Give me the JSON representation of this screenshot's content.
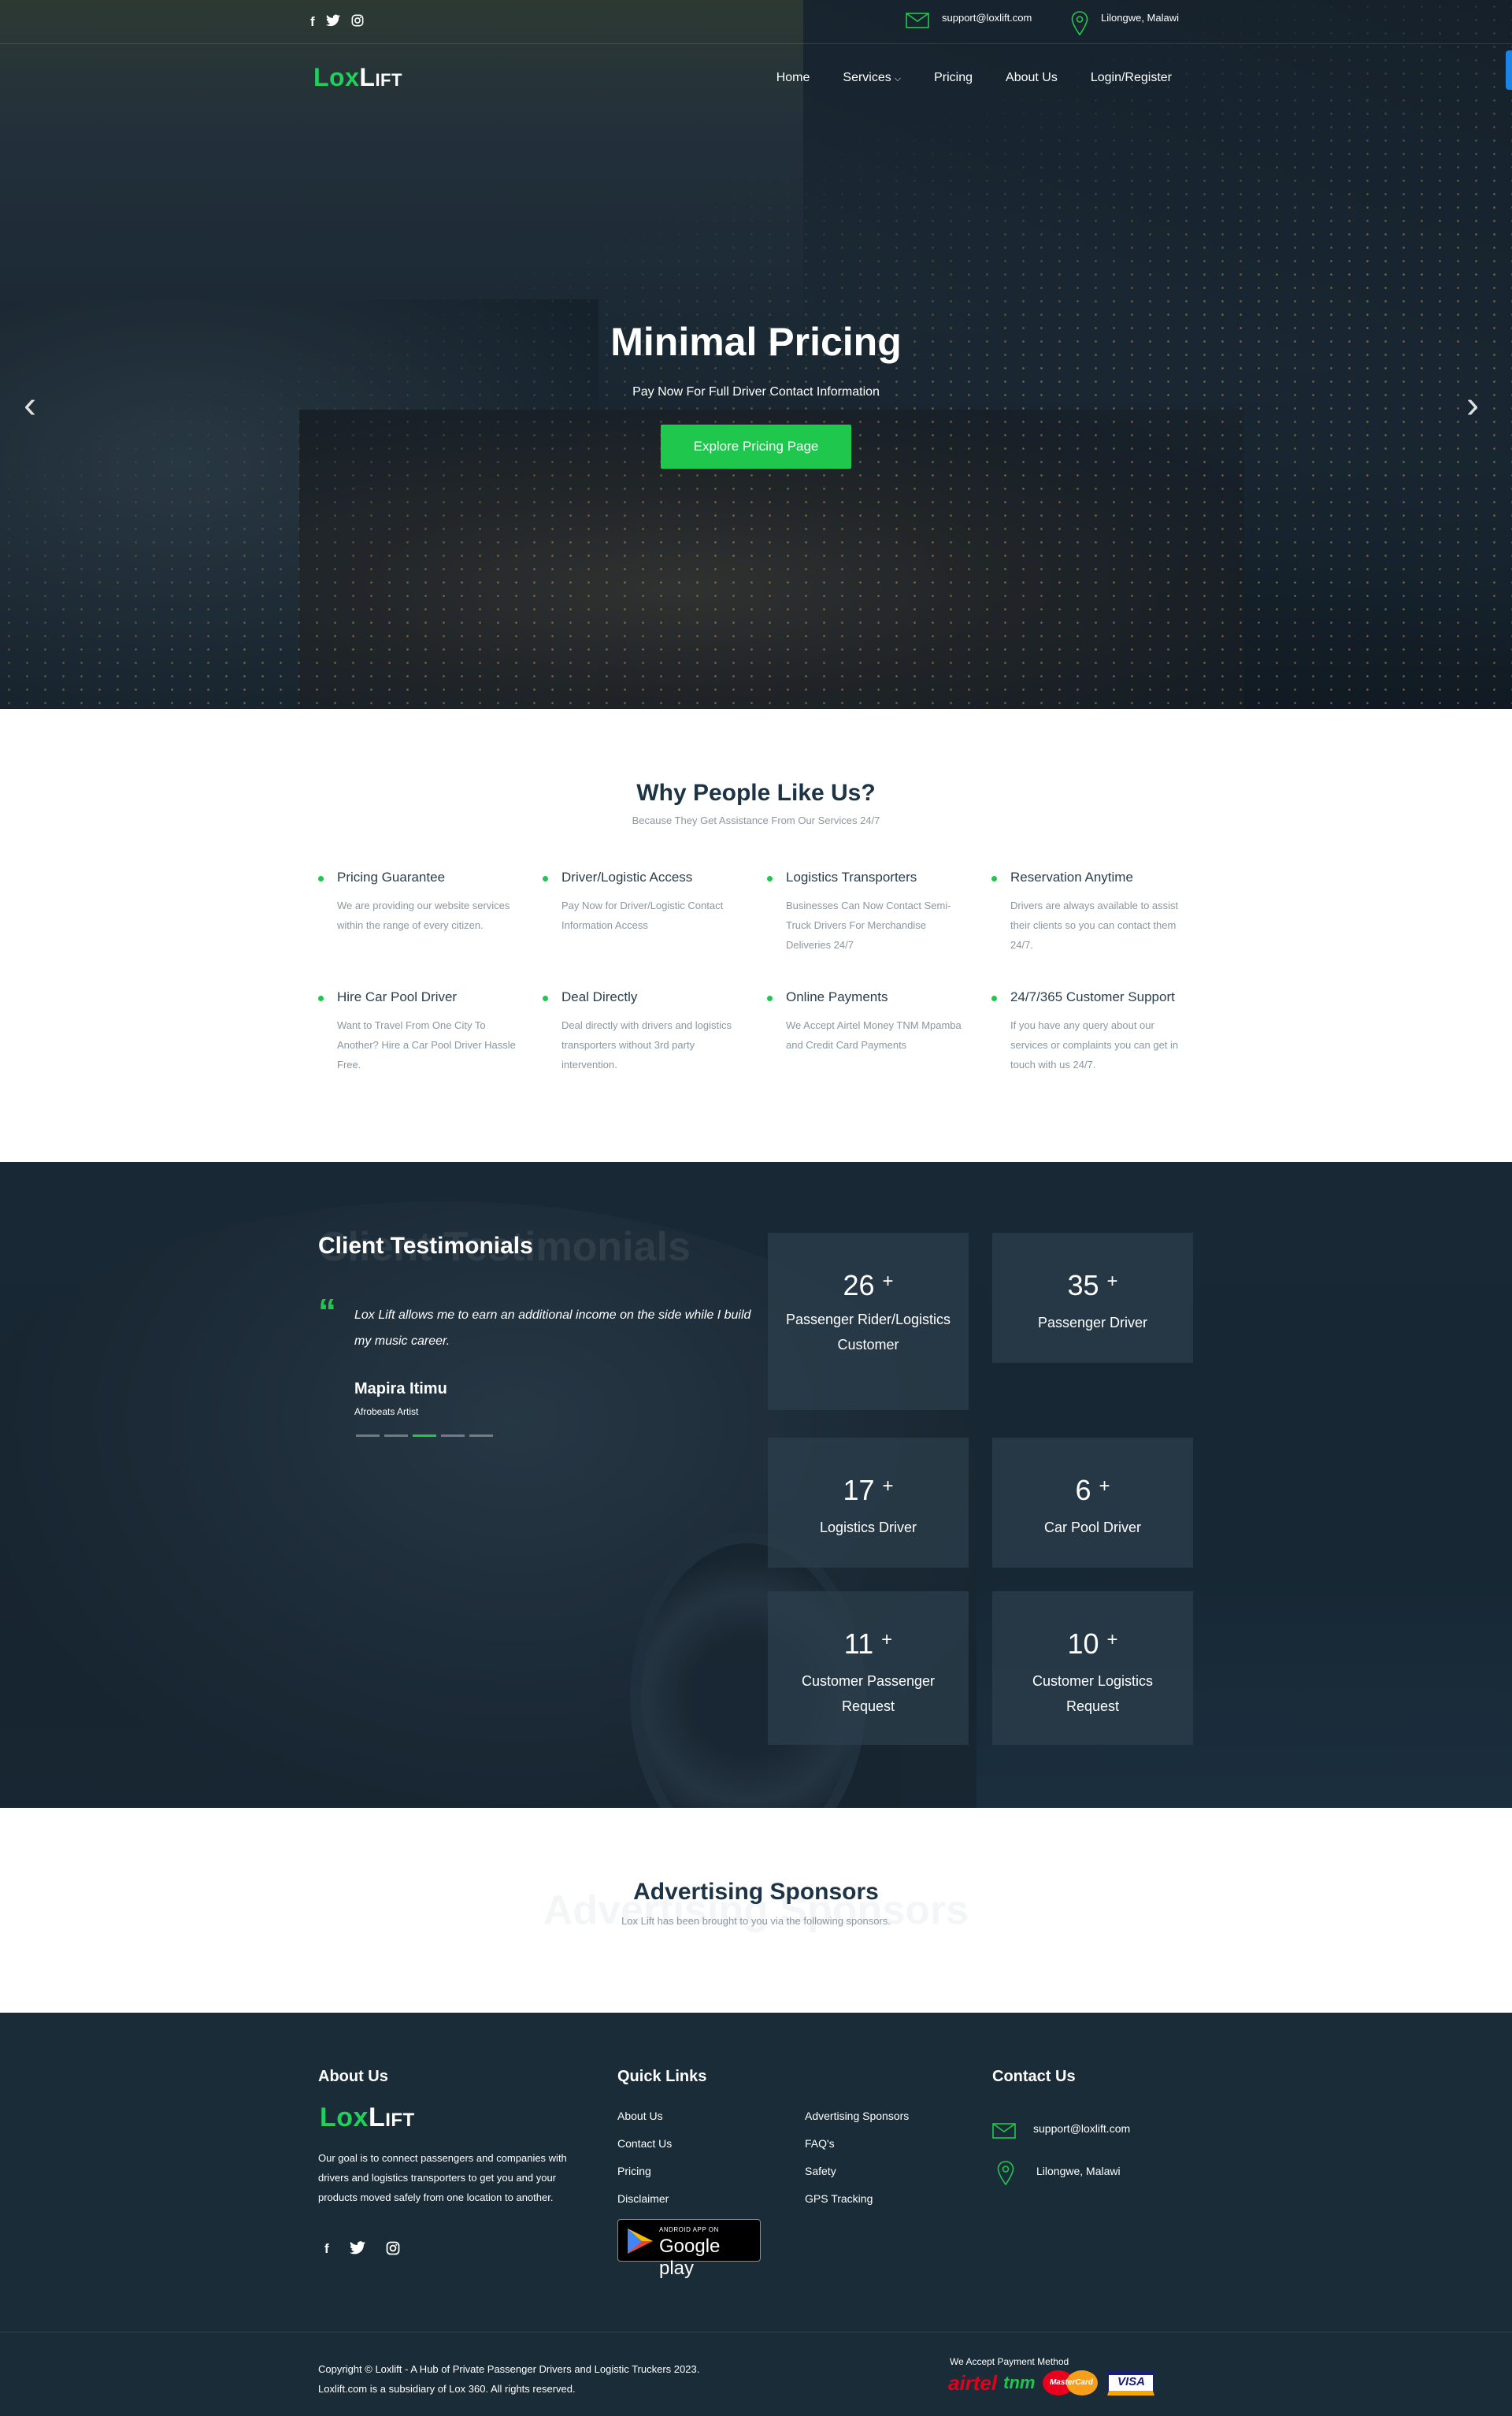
{
  "topbar": {
    "social": [
      "f",
      "🐦",
      "◎"
    ],
    "email": "support@loxlift.com",
    "location": "Lilongwe, Malawi"
  },
  "brand": {
    "part1": "Lox",
    "part2": "Lift"
  },
  "nav": [
    {
      "label": "Home"
    },
    {
      "label": "Services",
      "has_dropdown": true
    },
    {
      "label": "Pricing"
    },
    {
      "label": "About Us"
    },
    {
      "label": "Login/Register"
    }
  ],
  "hero": {
    "title": "Minimal Pricing",
    "subtitle": "Pay Now For Full Driver Contact Information",
    "button": "Explore Pricing Page",
    "prev_arrow": "‹",
    "next_arrow": "›"
  },
  "why": {
    "title": "Why People Like Us?",
    "subtitle": "Because They Get Assistance From Our Services 24/7",
    "features": [
      {
        "title": "Pricing Guarantee",
        "desc": "We are providing our website services within the range of every citizen."
      },
      {
        "title": "Driver/Logistic Access",
        "desc": "Pay Now for Driver/Logistic Contact Information Access"
      },
      {
        "title": "Logistics Transporters",
        "desc": "Businesses Can Now Contact Semi-Truck Drivers For Merchandise Deliveries 24/7"
      },
      {
        "title": "Reservation Anytime",
        "desc": "Drivers are always available to assist their clients so you can contact them 24/7."
      },
      {
        "title": "Hire Car Pool Driver",
        "desc": "Want to Travel From One City To Another? Hire a Car Pool Driver Hassle Free."
      },
      {
        "title": "Deal Directly",
        "desc": "Deal directly with drivers and logistics transporters without 3rd party intervention."
      },
      {
        "title": "Online Payments",
        "desc": "We Accept Airtel Money TNM Mpamba and Credit Card Payments"
      },
      {
        "title": "24/7/365 Customer Support",
        "desc": "If you have any query about our services or complaints you can get in touch with us 24/7."
      }
    ]
  },
  "testimonials": {
    "title": "Client Testimonials",
    "ghost": "Client Testimonials",
    "quote_mark": "“",
    "quote": "Lox Lift allows me to earn an additional income on the side while I build my music career.",
    "name": "Mapira Itimu",
    "role": "Afrobeats Artist",
    "slide_count": 5,
    "active_slide": 3
  },
  "stats": [
    {
      "value": "26",
      "suffix": "+",
      "label": "Passenger Rider/Logistics Customer"
    },
    {
      "value": "35",
      "suffix": "+",
      "label": "Passenger Driver"
    },
    {
      "value": "17",
      "suffix": "+",
      "label": "Logistics Driver"
    },
    {
      "value": "6",
      "suffix": "+",
      "label": "Car Pool Driver"
    },
    {
      "value": "11",
      "suffix": "+",
      "label": "Customer Passenger Request"
    },
    {
      "value": "10",
      "suffix": "+",
      "label": "Customer Logistics Request"
    }
  ],
  "sponsors": {
    "title": "Advertising Sponsors",
    "ghost": "Advertising Sponsors",
    "subtitle": "Lox Lift has been brought to you via the following sponsors."
  },
  "footer": {
    "about_heading": "About Us",
    "about_text": "Our goal is to connect passengers and companies with drivers and logistics transporters to get you and your products moved safely from one location to another.",
    "quick_heading": "Quick Links",
    "links_col1": [
      "About Us",
      "Contact Us",
      "Pricing",
      "Disclaimer"
    ],
    "links_col2": [
      "Advertising Sponsors",
      "FAQ's",
      "Safety",
      "GPS Tracking"
    ],
    "gplay_small": "ANDROID APP ON",
    "gplay_big": "Google play",
    "contact_heading": "Contact Us",
    "email": "support@loxlift.com",
    "location": "Lilongwe, Malawi",
    "copyright_line1": "Copyright © Loxlift - A Hub of Private Passenger Drivers and Logistic Truckers 2023.",
    "copyright_line2": "Loxlift.com is a subsidiary of Lox 360. All rights reserved.",
    "pay_label": "We Accept Payment Method",
    "pay_airtel": "airtel",
    "pay_tnm": "tnm",
    "pay_mc": "MasterCard",
    "pay_visa": "VISA"
  },
  "colors": {
    "accent": "#1fc84c",
    "dark": "#1a2c38",
    "heading": "#1d3446",
    "muted": "#8b96a0"
  }
}
